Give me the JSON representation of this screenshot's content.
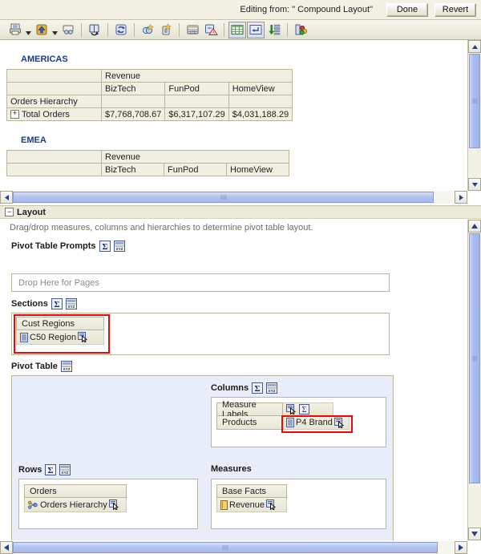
{
  "editbar": {
    "editing_from": "Editing from: \" Compound Layout\"",
    "done_label": "Done",
    "revert_label": "Revert"
  },
  "toolbar": {
    "buttons": [
      {
        "name": "print-icon",
        "title": "Print"
      },
      {
        "name": "print-dropdown-caret",
        "title": "Print options"
      },
      {
        "name": "export-icon",
        "title": "Export"
      },
      {
        "name": "export-dropdown-caret",
        "title": "Export options"
      },
      {
        "name": "preview-icon",
        "title": "Preview"
      },
      {
        "name": "refresh-view-icon",
        "title": "Refresh"
      },
      {
        "name": "reload-icon",
        "title": "Reload"
      },
      {
        "name": "new-calculated-item-icon",
        "title": "New Calculated Item"
      },
      {
        "name": "new-group-icon",
        "title": "New Group"
      },
      {
        "name": "totals-icon",
        "title": "Totals"
      },
      {
        "name": "remove-format-icon",
        "title": "Remove Formatting"
      },
      {
        "name": "table-view-icon",
        "title": "Table View",
        "selected": true
      },
      {
        "name": "pivot-layout-icon",
        "title": "Pivot Layout",
        "selected": true
      },
      {
        "name": "sort-descending-icon",
        "title": "Sort"
      },
      {
        "name": "graph-view-icon",
        "title": "Graph View"
      }
    ]
  },
  "results": {
    "sections": [
      {
        "label": "AMERICAS",
        "measure_header": "Revenue",
        "columns": [
          "BizTech",
          "FunPod",
          "HomeView"
        ],
        "row_group_label": "Orders Hierarchy",
        "rows": [
          {
            "label": "Total Orders",
            "expandable": true,
            "values": [
              "$7,768,708.67",
              "$6,317,107.29",
              "$4,031,188.29"
            ]
          }
        ]
      },
      {
        "label": "EMEA",
        "measure_header": "Revenue",
        "columns": [
          "BizTech",
          "FunPod",
          "HomeView"
        ],
        "row_group_label": "",
        "rows": []
      }
    ]
  },
  "layout": {
    "title": "Layout",
    "collapse_glyph": "−",
    "hint": "Drag/drop measures, columns and hierarchies to determine pivot table layout.",
    "prompts": {
      "label": "Pivot Table Prompts",
      "placeholder": "Drop Here for Pages"
    },
    "sections_zone": {
      "label": "Sections",
      "highlighted": true,
      "chip": {
        "header": "Cust Regions",
        "item": "C50  Region",
        "item_icon": "hierarchy-level-icon",
        "action_icon": "column-properties-icon"
      }
    },
    "pivot_table": {
      "label": "Pivot Table",
      "columns_zone": {
        "label": "Columns",
        "chips": [
          {
            "header": "Measure Labels",
            "item": "",
            "icons": [
              "column-properties-icon",
              "sigma-icon"
            ],
            "highlighted": false
          },
          {
            "header": "Products",
            "item": "P4  Brand",
            "item_icon": "hierarchy-level-icon",
            "action_icon": "column-properties-icon",
            "highlighted": true
          }
        ]
      },
      "rows_zone": {
        "label": "Rows",
        "chip": {
          "header": "Orders",
          "item": "Orders Hierarchy",
          "item_icon": "hierarchy-icon",
          "action_icon": "column-properties-icon"
        }
      },
      "measures_zone": {
        "label": "Measures",
        "chip": {
          "header": "Base Facts",
          "item": "Revenue",
          "item_icon": "measure-icon",
          "action_icon": "column-properties-icon"
        }
      }
    }
  },
  "colors": {
    "accent_blue": "#1a3b8b",
    "highlight_red": "#ff0000",
    "panel_bg": "#e9edf9",
    "chrome_beige": "#eceadb"
  }
}
